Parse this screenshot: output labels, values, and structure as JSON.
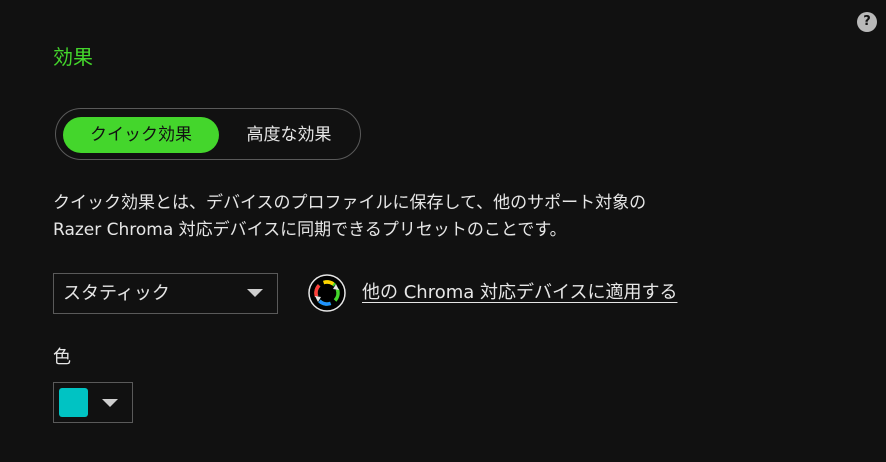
{
  "help": {
    "label": "?"
  },
  "section": {
    "title": "効果"
  },
  "effect_toggle": {
    "options": [
      {
        "label": "クイック効果",
        "selected": true
      },
      {
        "label": "高度な効果",
        "selected": false
      }
    ]
  },
  "description": {
    "line1": "クイック効果とは、デバイスのプロファイルに保存して、他のサポート対象の",
    "line2": "Razer Chroma 対応デバイスに同期できるプリセットのことです。"
  },
  "effect_dropdown": {
    "value": "スタティック",
    "icon": "chevron-down-icon"
  },
  "chroma_link": {
    "label": "他の Chroma 対応デバイスに適用する",
    "icon": "chroma-sync-icon"
  },
  "color": {
    "label": "色",
    "swatch_color": "#00c3c3",
    "icon": "chevron-down-icon"
  },
  "colors": {
    "accent": "#44d62c",
    "background": "#111111",
    "text": "#e6e6e6",
    "border": "#5a5a5a"
  }
}
